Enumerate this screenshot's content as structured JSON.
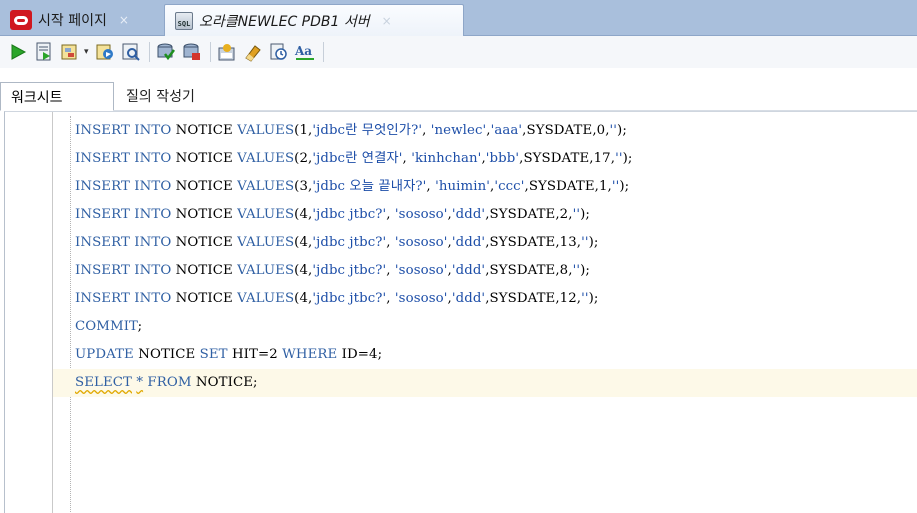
{
  "tabs": [
    {
      "label": "시작 페이지",
      "close": "×",
      "icon": "oracle-logo-icon"
    },
    {
      "label": "오라클NEWLEC PDB1 서버",
      "close": "×",
      "icon": "sql-connection-icon"
    }
  ],
  "toolbar": {
    "icons": [
      "run-statement-icon",
      "run-script-icon",
      "explain-plan-icon",
      "autotrace-icon",
      "sql-tuning-icon",
      "commit-icon",
      "rollback-icon",
      "unshared-sql-icon",
      "clear-icon",
      "sql-history-icon",
      "format-icon"
    ],
    "dropdown_glyph": "▾"
  },
  "subtabs": {
    "worksheet": "워크시트",
    "query_builder": "질의 작성기"
  },
  "editor": {
    "lines": [
      [
        [
          "kw",
          "INSERT "
        ],
        [
          "kw",
          "INTO "
        ],
        [
          "id",
          "NOTICE "
        ],
        [
          "kw",
          "VALUES"
        ],
        [
          "p",
          "("
        ],
        [
          "num",
          "1"
        ],
        [
          "p",
          ","
        ],
        [
          "str",
          "'jdbc란 무엇인가?'"
        ],
        [
          "p",
          ", "
        ],
        [
          "str",
          "'newlec'"
        ],
        [
          "p",
          ","
        ],
        [
          "str",
          "'aaa'"
        ],
        [
          "p",
          ","
        ],
        [
          "id",
          "SYSDATE"
        ],
        [
          "p",
          ","
        ],
        [
          "num",
          "0"
        ],
        [
          "p",
          ","
        ],
        [
          "str",
          "''"
        ],
        [
          "p",
          ");"
        ]
      ],
      [
        [
          "kw",
          "INSERT "
        ],
        [
          "kw",
          "INTO "
        ],
        [
          "id",
          "NOTICE "
        ],
        [
          "kw",
          "VALUES"
        ],
        [
          "p",
          "("
        ],
        [
          "num",
          "2"
        ],
        [
          "p",
          ","
        ],
        [
          "str",
          "'jdbc란 연결자'"
        ],
        [
          "p",
          ", "
        ],
        [
          "str",
          "'kinhchan'"
        ],
        [
          "p",
          ","
        ],
        [
          "str",
          "'bbb'"
        ],
        [
          "p",
          ","
        ],
        [
          "id",
          "SYSDATE"
        ],
        [
          "p",
          ","
        ],
        [
          "num",
          "17"
        ],
        [
          "p",
          ","
        ],
        [
          "str",
          "''"
        ],
        [
          "p",
          ");"
        ]
      ],
      [
        [
          "kw",
          "INSERT "
        ],
        [
          "kw",
          "INTO "
        ],
        [
          "id",
          "NOTICE "
        ],
        [
          "kw",
          "VALUES"
        ],
        [
          "p",
          "("
        ],
        [
          "num",
          "3"
        ],
        [
          "p",
          ","
        ],
        [
          "str",
          "'jdbc 오늘 끝내자?'"
        ],
        [
          "p",
          ", "
        ],
        [
          "str",
          "'huimin'"
        ],
        [
          "p",
          ","
        ],
        [
          "str",
          "'ccc'"
        ],
        [
          "p",
          ","
        ],
        [
          "id",
          "SYSDATE"
        ],
        [
          "p",
          ","
        ],
        [
          "num",
          "1"
        ],
        [
          "p",
          ","
        ],
        [
          "str",
          "''"
        ],
        [
          "p",
          ");"
        ]
      ],
      [
        [
          "kw",
          "INSERT "
        ],
        [
          "kw",
          "INTO "
        ],
        [
          "id",
          "NOTICE "
        ],
        [
          "kw",
          "VALUES"
        ],
        [
          "p",
          "("
        ],
        [
          "num",
          "4"
        ],
        [
          "p",
          ","
        ],
        [
          "str",
          "'jdbc jtbc?'"
        ],
        [
          "p",
          ", "
        ],
        [
          "str",
          "'sososo'"
        ],
        [
          "p",
          ","
        ],
        [
          "str",
          "'ddd'"
        ],
        [
          "p",
          ","
        ],
        [
          "id",
          "SYSDATE"
        ],
        [
          "p",
          ","
        ],
        [
          "num",
          "2"
        ],
        [
          "p",
          ","
        ],
        [
          "str",
          "''"
        ],
        [
          "p",
          ");"
        ]
      ],
      [
        [
          "kw",
          "INSERT "
        ],
        [
          "kw",
          "INTO "
        ],
        [
          "id",
          "NOTICE "
        ],
        [
          "kw",
          "VALUES"
        ],
        [
          "p",
          "("
        ],
        [
          "num",
          "4"
        ],
        [
          "p",
          ","
        ],
        [
          "str",
          "'jdbc jtbc?'"
        ],
        [
          "p",
          ", "
        ],
        [
          "str",
          "'sososo'"
        ],
        [
          "p",
          ","
        ],
        [
          "str",
          "'ddd'"
        ],
        [
          "p",
          ","
        ],
        [
          "id",
          "SYSDATE"
        ],
        [
          "p",
          ","
        ],
        [
          "num",
          "13"
        ],
        [
          "p",
          ","
        ],
        [
          "str",
          "''"
        ],
        [
          "p",
          ");"
        ]
      ],
      [
        [
          "kw",
          "INSERT "
        ],
        [
          "kw",
          "INTO "
        ],
        [
          "id",
          "NOTICE "
        ],
        [
          "kw",
          "VALUES"
        ],
        [
          "p",
          "("
        ],
        [
          "num",
          "4"
        ],
        [
          "p",
          ","
        ],
        [
          "str",
          "'jdbc jtbc?'"
        ],
        [
          "p",
          ", "
        ],
        [
          "str",
          "'sososo'"
        ],
        [
          "p",
          ","
        ],
        [
          "str",
          "'ddd'"
        ],
        [
          "p",
          ","
        ],
        [
          "id",
          "SYSDATE"
        ],
        [
          "p",
          ","
        ],
        [
          "num",
          "8"
        ],
        [
          "p",
          ","
        ],
        [
          "str",
          "''"
        ],
        [
          "p",
          ");"
        ]
      ],
      [
        [
          "kw",
          "INSERT "
        ],
        [
          "kw",
          "INTO "
        ],
        [
          "id",
          "NOTICE "
        ],
        [
          "kw",
          "VALUES"
        ],
        [
          "p",
          "("
        ],
        [
          "num",
          "4"
        ],
        [
          "p",
          ","
        ],
        [
          "str",
          "'jdbc jtbc?'"
        ],
        [
          "p",
          ", "
        ],
        [
          "str",
          "'sososo'"
        ],
        [
          "p",
          ","
        ],
        [
          "str",
          "'ddd'"
        ],
        [
          "p",
          ","
        ],
        [
          "id",
          "SYSDATE"
        ],
        [
          "p",
          ","
        ],
        [
          "num",
          "12"
        ],
        [
          "p",
          ","
        ],
        [
          "str",
          "''"
        ],
        [
          "p",
          ");"
        ]
      ],
      [
        [
          "kw",
          "COMMIT"
        ],
        [
          "p",
          ";"
        ]
      ],
      [
        [
          "kw",
          "UPDATE "
        ],
        [
          "id",
          "NOTICE "
        ],
        [
          "kw",
          "SET "
        ],
        [
          "id",
          "HIT"
        ],
        [
          "p",
          "="
        ],
        [
          "num",
          "2 "
        ],
        [
          "kw",
          "WHERE "
        ],
        [
          "id",
          "ID"
        ],
        [
          "p",
          "="
        ],
        [
          "num",
          "4"
        ],
        [
          "p",
          ";"
        ]
      ],
      [
        [
          "kw wavy",
          "SELECT"
        ],
        [
          "p",
          " "
        ],
        [
          "kw wavy",
          "*"
        ],
        [
          "p",
          " "
        ],
        [
          "kw",
          "FROM "
        ],
        [
          "id",
          "NOTICE"
        ],
        [
          "p",
          ";"
        ]
      ]
    ],
    "current_line": 9
  },
  "colors": {
    "keyword": "#2f5fa3",
    "string": "#1d4ea8",
    "tabbar": "#a9bfdc",
    "current_line": "#fdf9e8"
  }
}
